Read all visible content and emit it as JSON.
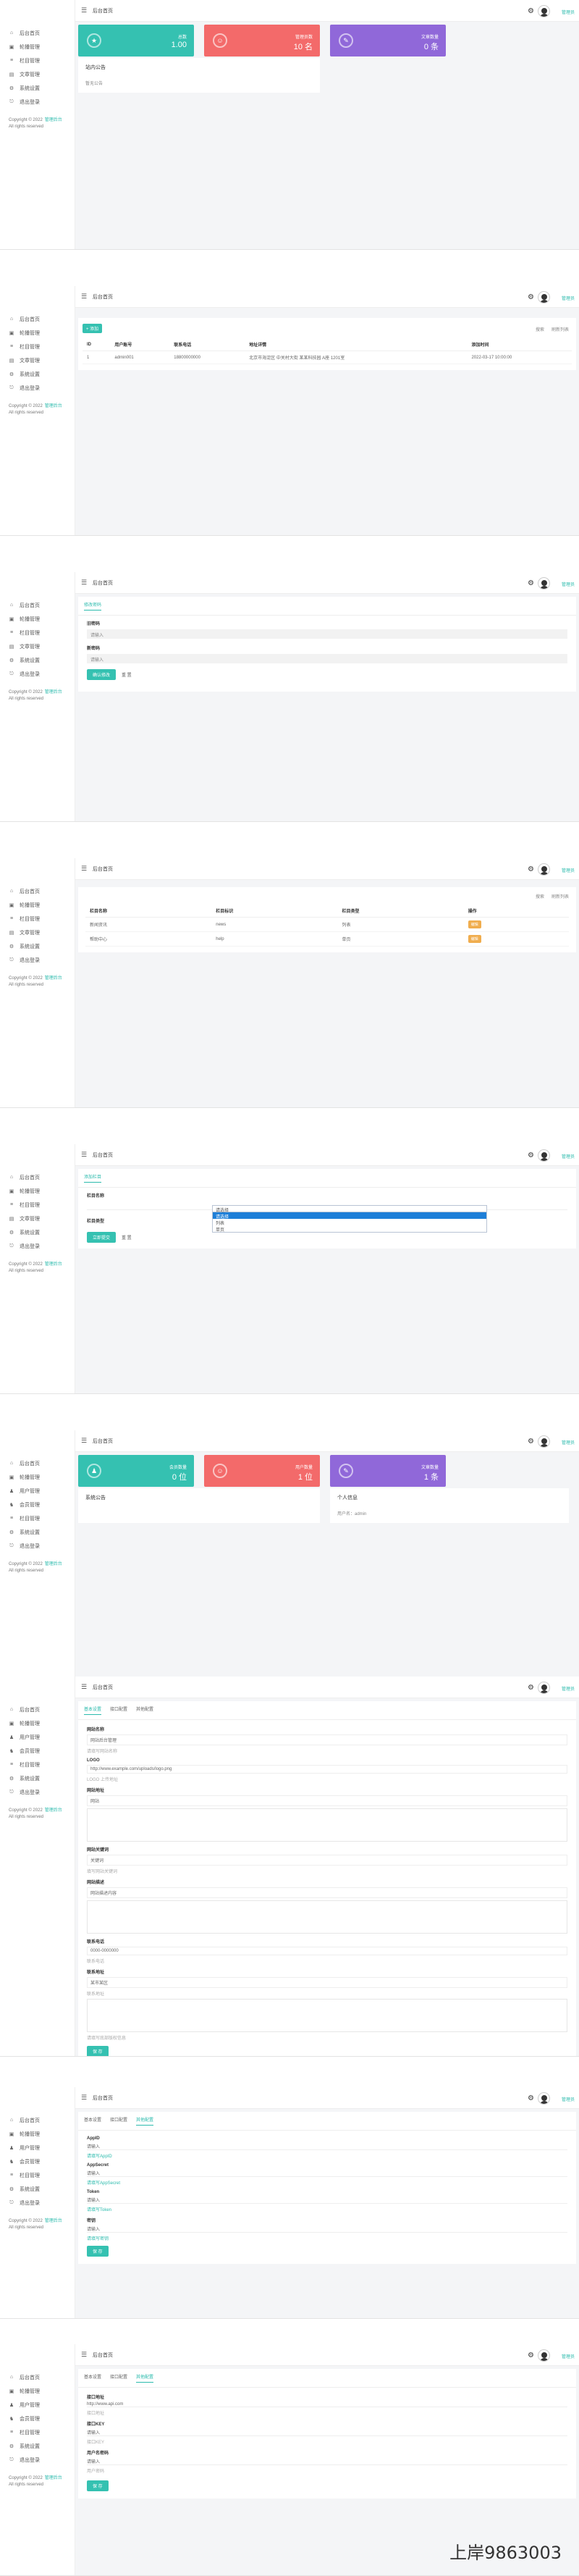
{
  "app": {
    "title": "后台首页",
    "username": "管理员",
    "copyright_line1": "Copyright © 2022",
    "copyright_link": "管理后台",
    "copyright_line2": "All rights reserved"
  },
  "nav_basic": [
    {
      "label": "后台首页",
      "icon": "home-icon",
      "glyph": "⌂"
    },
    {
      "label": "轮播管理",
      "icon": "image-icon",
      "glyph": "▣"
    },
    {
      "label": "栏目管理",
      "icon": "list-icon",
      "glyph": "≡"
    },
    {
      "label": "文章管理",
      "icon": "file-icon",
      "glyph": "▤"
    },
    {
      "label": "系统设置",
      "icon": "gear-icon",
      "glyph": "⚙"
    },
    {
      "label": "退出登录",
      "icon": "logout-icon",
      "glyph": "⎋"
    }
  ],
  "nav_full": [
    {
      "label": "后台首页",
      "icon": "home-icon",
      "glyph": "⌂"
    },
    {
      "label": "轮播管理",
      "icon": "image-icon",
      "glyph": "▣"
    },
    {
      "label": "用户管理",
      "icon": "user-icon",
      "glyph": "♟"
    },
    {
      "label": "会员管理",
      "icon": "users-icon",
      "glyph": "♞"
    },
    {
      "label": "栏目管理",
      "icon": "list-icon",
      "glyph": "≡"
    },
    {
      "label": "系统设置",
      "icon": "gear-icon",
      "glyph": "⚙"
    },
    {
      "label": "退出登录",
      "icon": "logout-icon",
      "glyph": "⎋"
    }
  ],
  "s1": {
    "stats": [
      {
        "label": "总数",
        "value": "1.00",
        "glyph": "★"
      },
      {
        "label": "管理员数",
        "value": "10 名",
        "glyph": "☺"
      },
      {
        "label": "文章数量",
        "value": "0 条",
        "glyph": "✎"
      }
    ],
    "panel_title": "站内公告",
    "panel_text": "暂无公告"
  },
  "s2": {
    "add_button": "+ 添加",
    "toolbar_right": [
      "搜索",
      "刷新列表"
    ],
    "columns": [
      "ID",
      "用户账号",
      "联系电话",
      "地址详情",
      "添加时间"
    ],
    "rows": [
      [
        "1",
        "admin001",
        "18800000000",
        "北京市海淀区 中关村大街 某某科技园 A座 1201室",
        "2022-03-17 10:00:00"
      ]
    ]
  },
  "s3": {
    "tab": "修改密码",
    "fields": [
      {
        "label": "旧密码",
        "placeholder": "请输入"
      },
      {
        "label": "新密码",
        "placeholder": "请输入"
      }
    ],
    "submit": "确认修改",
    "reset": "重 置"
  },
  "s4": {
    "toolbar_right": [
      "搜索",
      "刷新列表"
    ],
    "columns": [
      "栏目名称",
      "栏目标识",
      "栏目类型",
      "操作"
    ],
    "rows": [
      {
        "name": "新闻资讯",
        "code": "news",
        "type": "列表",
        "action": "编辑"
      },
      {
        "name": "帮助中心",
        "code": "help",
        "type": "单页",
        "action": "编辑"
      }
    ]
  },
  "s5": {
    "tab": "添加栏目",
    "name_label": "栏目名称",
    "type_label": "栏目类型",
    "select_value": "请选择",
    "options": [
      "请选择",
      "列表",
      "单页"
    ],
    "submit": "立即提交",
    "reset": "重 置"
  },
  "s6": {
    "stats": [
      {
        "label": "会员数量",
        "value": "0 位",
        "glyph": "♟"
      },
      {
        "label": "用户数量",
        "value": "1 位",
        "glyph": "☺"
      },
      {
        "label": "文章数量",
        "value": "1 条",
        "glyph": "✎"
      }
    ],
    "left_title": "系统公告",
    "right_title": "个人信息",
    "right_text": "用户名：admin"
  },
  "s7": {
    "tabs": [
      "基本设置",
      "接口配置",
      "其他配置"
    ],
    "fields": [
      {
        "label": "网站名称",
        "value": "网站后台管理",
        "hint": "请填写网站名称"
      },
      {
        "label": "LOGO",
        "value": "http://www.example.com/uploads/logo.png",
        "hint": "LOGO 上传地址"
      },
      {
        "label": "网站地址",
        "value": "网站",
        "hint": ""
      }
    ],
    "fields2": [
      {
        "label": "网站关键词",
        "value": "关键词",
        "hint": "填写网站关键词"
      },
      {
        "label": "网站描述",
        "value": "网站描述内容",
        "hint": ""
      }
    ],
    "fields3": [
      {
        "label": "联系电话",
        "value": "0000-0000000",
        "hint": "联系电话"
      },
      {
        "label": "联系地址",
        "value": "某市某区",
        "hint": "联系地址"
      }
    ],
    "foot_hint": "请填写底部版权信息",
    "submit": "保 存"
  },
  "s8": {
    "tabs": [
      "基本设置",
      "接口配置",
      "其他配置"
    ],
    "fields": [
      {
        "label": "AppID",
        "value": "请输入",
        "hint": "请填写AppID"
      },
      {
        "label": "AppSecret",
        "value": "请输入",
        "hint": "请填写AppSecret"
      },
      {
        "label": "Token",
        "value": "请输入",
        "hint": "请填写Token"
      },
      {
        "label": "密钥",
        "value": "请输入",
        "hint": "请填写密钥"
      }
    ],
    "submit": "保 存"
  },
  "s9": {
    "tabs": [
      "基本设置",
      "接口配置",
      "其他配置"
    ],
    "fields": [
      {
        "label": "接口地址",
        "value": "http://www.api.com",
        "hint": "接口地址"
      },
      {
        "label": "接口KEY",
        "value": "请输入",
        "hint": "接口KEY"
      },
      {
        "label": "用户名密码",
        "value": "请输入",
        "hint": "用户密码"
      }
    ],
    "submit": "保 存"
  },
  "watermark": "上岸9863003"
}
